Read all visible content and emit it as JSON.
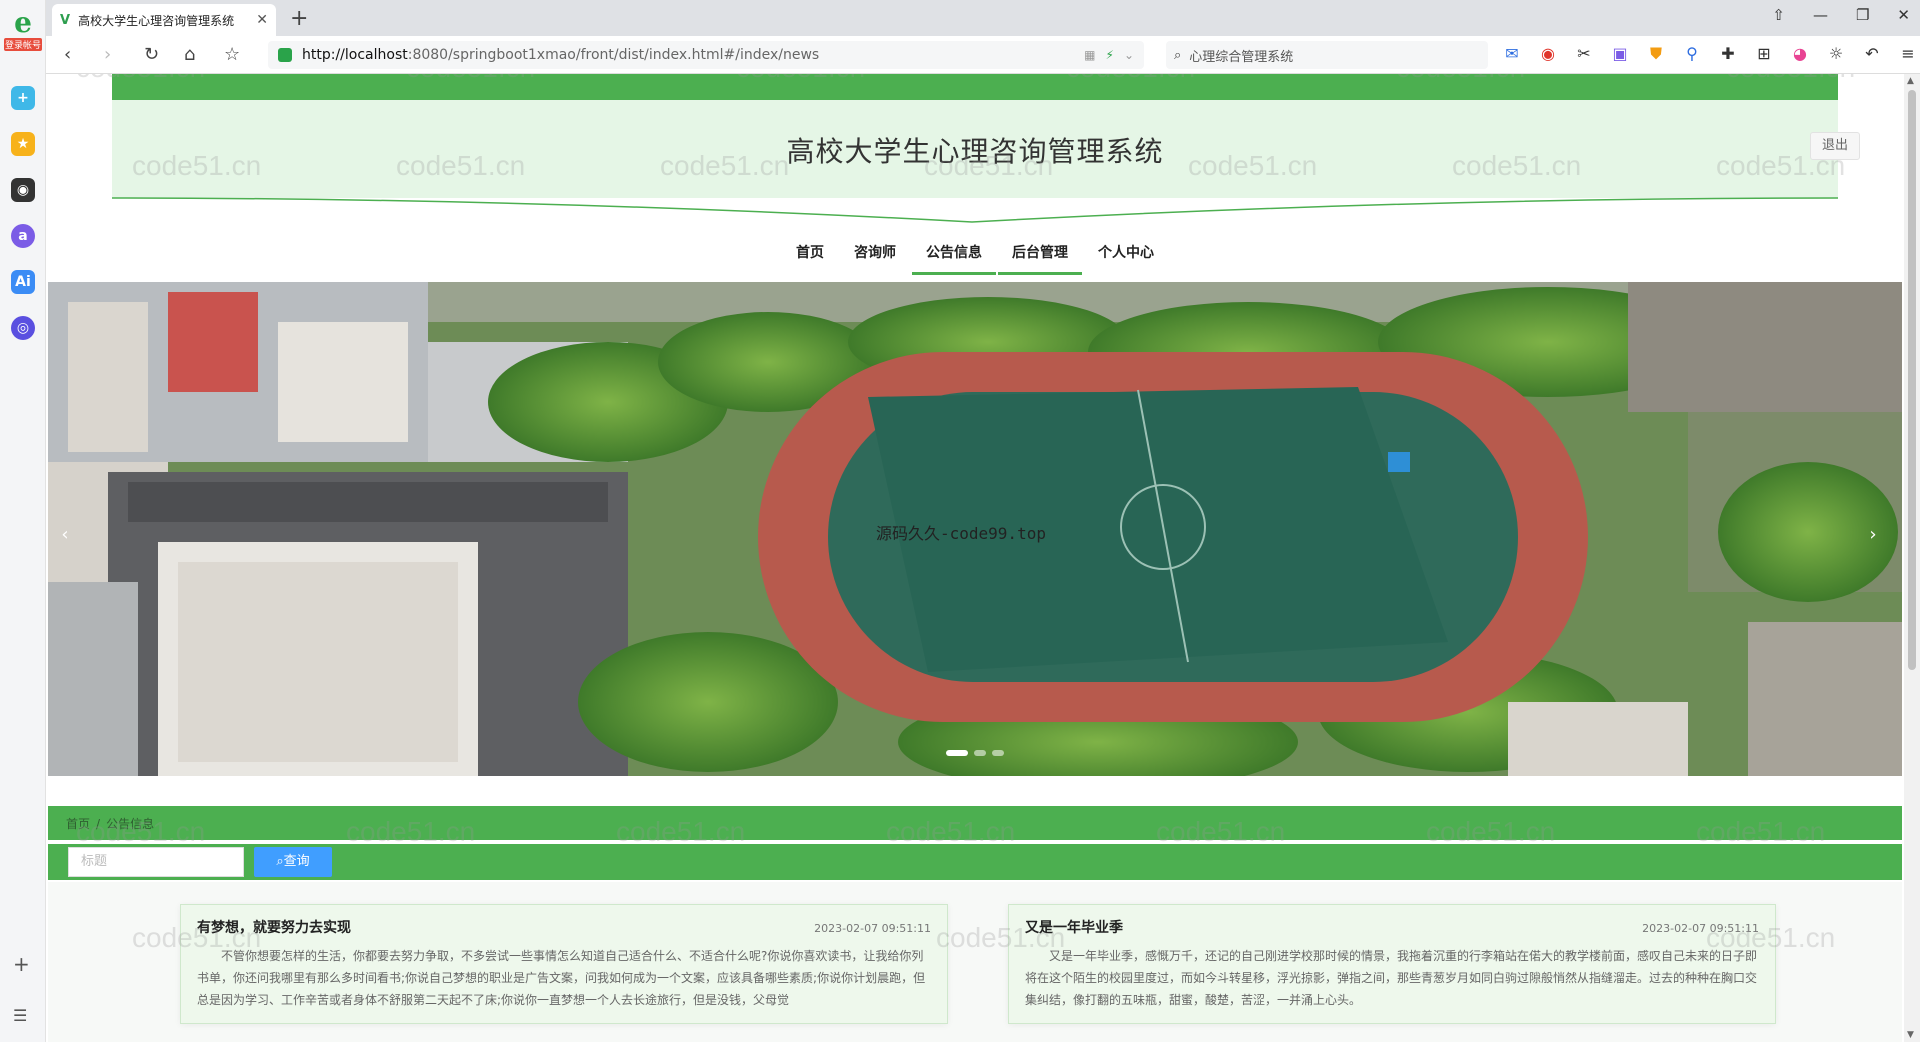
{
  "browser": {
    "logo_badge": "登录帐号",
    "tab_title": "高校大学生心理咨询管理系统",
    "url_host": "http://localhost",
    "url_rest": ":8080/springboot1xmao/front/dist/index.html#/index/news",
    "search_text": "心理综合管理系统"
  },
  "site": {
    "title": "高校大学生心理咨询管理系统",
    "logout_label": "退出"
  },
  "menu": [
    {
      "label": "首页"
    },
    {
      "label": "咨询师"
    },
    {
      "label": "公告信息"
    },
    {
      "label": "后台管理"
    },
    {
      "label": "个人中心"
    }
  ],
  "banner": {
    "overlay_text": "源码久久-code99.top",
    "dot_count": 3,
    "active_dot": 1
  },
  "breadcrumb": {
    "home": "首页",
    "separator": "/",
    "current": "公告信息"
  },
  "filter": {
    "placeholder": "标题",
    "button_label": "查询"
  },
  "news": [
    {
      "title": "有梦想，就要努力去实现",
      "date": "2023-02-07 09:51:11",
      "content": "不管你想要怎样的生活，你都要去努力争取，不多尝试一些事情怎么知道自己适合什么、不适合什么呢?你说你喜欢读书，让我给你列书单，你还问我哪里有那么多时间看书;你说自己梦想的职业是广告文案，问我如何成为一个文案，应该具备哪些素质;你说你计划晨跑，但总是因为学习、工作辛苦或者身体不舒服第二天起不了床;你说你一直梦想一个人去长途旅行，但是没钱，父母觉"
    },
    {
      "title": "又是一年毕业季",
      "date": "2023-02-07 09:51:11",
      "content": "又是一年毕业季，感慨万千，还记的自己刚进学校那时候的情景，我拖着沉重的行李箱站在偌大的教学楼前面，感叹自己未来的日子即将在这个陌生的校园里度过，而如今斗转星移，浮光掠影，弹指之间，那些青葱岁月如同白驹过隙般悄然从指缝溜走。过去的种种在胸口交集纠结，像打翻的五味瓶，甜蜜，酸楚，苦涩，一并涌上心头。"
    }
  ],
  "watermark": "code51.cn",
  "colors": {
    "accent_green": "#4caf50",
    "hero_bg": "#e5f6e6",
    "query_button": "#409eff"
  }
}
